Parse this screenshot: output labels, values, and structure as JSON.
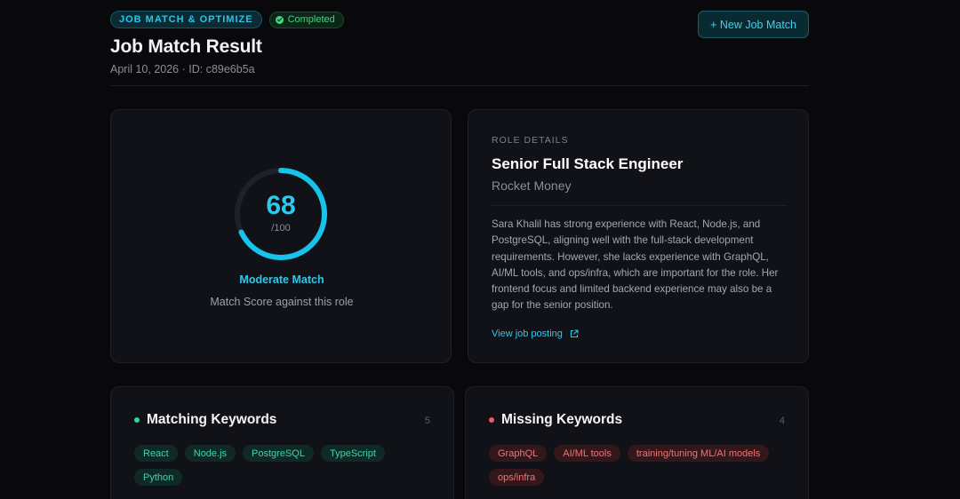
{
  "colors": {
    "background": "#09090c",
    "card": "#111217",
    "accent": "#2cc9ec",
    "success": "#3fd67c",
    "match_chip": "#3fd4a9",
    "missing_chip": "#f07575"
  },
  "header": {
    "section_badge": "JOB MATCH & OPTIMIZE",
    "status_badge": "Completed",
    "title": "Job Match Result",
    "meta": "April 10, 2026 · ID: c89e6b5a",
    "new_button": "+ New Job Match"
  },
  "score": {
    "value": "68",
    "max": "/100",
    "value_fraction": 0.68,
    "label": "Moderate Match",
    "subtitle": "Match Score against this role"
  },
  "role": {
    "eyebrow": "ROLE DETAILS",
    "title": "Senior Full Stack Engineer",
    "company": "Rocket Money",
    "summary": "Sara Khalil has strong experience with React, Node.js, and PostgreSQL, aligning well with the full-stack development requirements. However, she lacks experience with GraphQL, AI/ML tools, and ops/infra, which are important for the role. Her frontend focus and limited backend experience may also be a gap for the senior position.",
    "link": "View job posting",
    "link_icon": "external-link-icon"
  },
  "matching": {
    "title": "Matching Keywords",
    "count": "5",
    "items": [
      "React",
      "Node.js",
      "PostgreSQL",
      "TypeScript",
      "Python"
    ]
  },
  "missing": {
    "title": "Missing Keywords",
    "count": "4",
    "items": [
      "GraphQL",
      "AI/ML tools",
      "training/tuning ML/AI models",
      "ops/infra"
    ]
  }
}
